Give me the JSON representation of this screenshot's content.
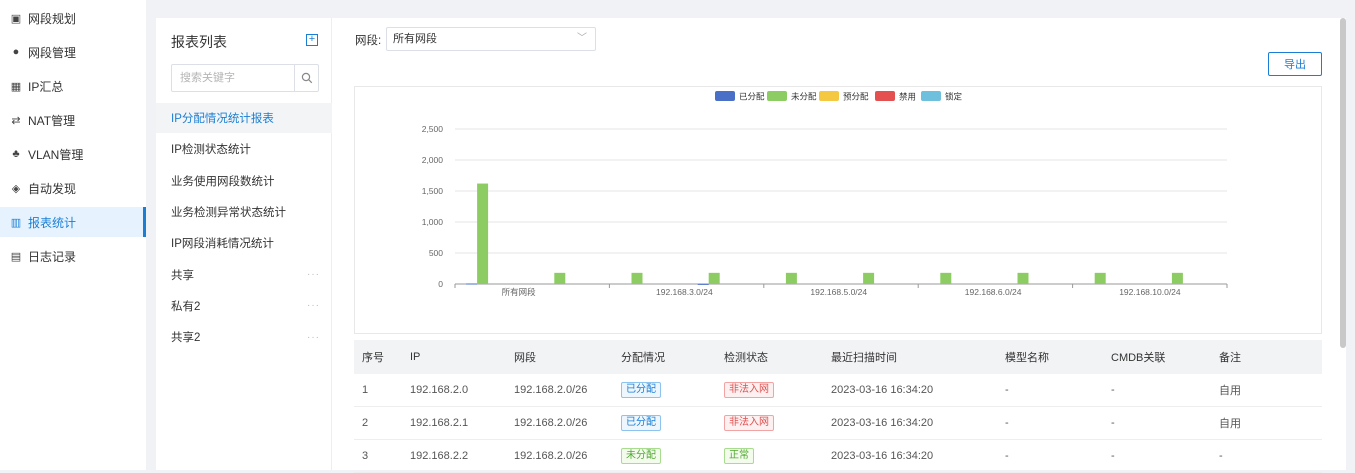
{
  "nav": {
    "items": [
      {
        "label": "网段规划",
        "icon": "grid-icon",
        "glyph": "▣"
      },
      {
        "label": "网段管理",
        "icon": "globe-icon",
        "glyph": "●"
      },
      {
        "label": "IP汇总",
        "icon": "table-icon",
        "glyph": "▦"
      },
      {
        "label": "NAT管理",
        "icon": "nat-icon",
        "glyph": "⇄"
      },
      {
        "label": "VLAN管理",
        "icon": "vlan-icon",
        "glyph": "♣"
      },
      {
        "label": "自动发现",
        "icon": "discover-icon",
        "glyph": "◈"
      },
      {
        "label": "报表统计",
        "icon": "chart-icon",
        "glyph": "▥",
        "active": true
      },
      {
        "label": "日志记录",
        "icon": "log-icon",
        "glyph": "▤"
      }
    ]
  },
  "reports": {
    "title": "报表列表",
    "add_icon": "plus-square-icon",
    "search_placeholder": "搜索关键字",
    "search_icon": "search-icon",
    "items": [
      {
        "label": "IP分配情况统计报表",
        "active": true
      },
      {
        "label": "IP检测状态统计"
      },
      {
        "label": "业务使用网段数统计"
      },
      {
        "label": "业务检测异常状态统计"
      },
      {
        "label": "IP网段消耗情况统计"
      },
      {
        "label": "共享",
        "more": "···"
      },
      {
        "label": "私有2",
        "more": "···"
      },
      {
        "label": "共享2",
        "more": "···"
      }
    ]
  },
  "filter": {
    "label": "网段:",
    "value": "所有网段",
    "export_label": "导出"
  },
  "chart_data": {
    "type": "bar",
    "legend": [
      "已分配",
      "未分配",
      "预分配",
      "禁用",
      "锁定"
    ],
    "colors": [
      "#4a6fc7",
      "#8ccc62",
      "#f5c842",
      "#e45050",
      "#6ec0dc"
    ],
    "legend_position": "top",
    "x_tick_labels": [
      "所有网段",
      "192.168.3.0/24",
      "192.168.5.0/24",
      "192.168.6.0/24",
      "192.168.10.0/24"
    ],
    "categories": [
      "所有网段",
      "",
      "",
      "",
      "",
      "",
      "",
      "",
      "",
      ""
    ],
    "series": [
      {
        "name": "已分配",
        "values": [
          8,
          0,
          0,
          2,
          0,
          0,
          0,
          0,
          0,
          0
        ]
      },
      {
        "name": "未分配",
        "values": [
          1620,
          180,
          180,
          180,
          180,
          180,
          180,
          180,
          180,
          180
        ]
      },
      {
        "name": "预分配",
        "values": [
          0,
          0,
          0,
          0,
          0,
          0,
          0,
          0,
          0,
          0
        ]
      },
      {
        "name": "禁用",
        "values": [
          0,
          0,
          0,
          0,
          0,
          0,
          0,
          0,
          0,
          0
        ]
      },
      {
        "name": "锁定",
        "values": [
          0,
          0,
          0,
          0,
          0,
          0,
          0,
          0,
          0,
          0
        ]
      }
    ],
    "y_ticks": [
      "0",
      "500",
      "1,000",
      "1,500",
      "2,000",
      "2,500"
    ],
    "ylim": [
      0,
      2500
    ],
    "grid": true
  },
  "table": {
    "headers": [
      "序号",
      "IP",
      "网段",
      "分配情况",
      "检测状态",
      "最近扫描时间",
      "模型名称",
      "CMDB关联",
      "备注"
    ],
    "rows": [
      {
        "no": "1",
        "ip": "192.168.2.0",
        "segment": "192.168.2.0/26",
        "alloc": "已分配",
        "alloc_color": "blue",
        "status": "非法入网",
        "status_color": "red",
        "time": "2023-03-16 16:34:20",
        "model": "-",
        "cmdb": "-",
        "note": "自用"
      },
      {
        "no": "2",
        "ip": "192.168.2.1",
        "segment": "192.168.2.0/26",
        "alloc": "已分配",
        "alloc_color": "blue",
        "status": "非法入网",
        "status_color": "red",
        "time": "2023-03-16 16:34:20",
        "model": "-",
        "cmdb": "-",
        "note": "自用"
      },
      {
        "no": "3",
        "ip": "192.168.2.2",
        "segment": "192.168.2.0/26",
        "alloc": "未分配",
        "alloc_color": "green",
        "status": "正常",
        "status_color": "green",
        "time": "2023-03-16 16:34:20",
        "model": "-",
        "cmdb": "-",
        "note": "-"
      }
    ]
  }
}
